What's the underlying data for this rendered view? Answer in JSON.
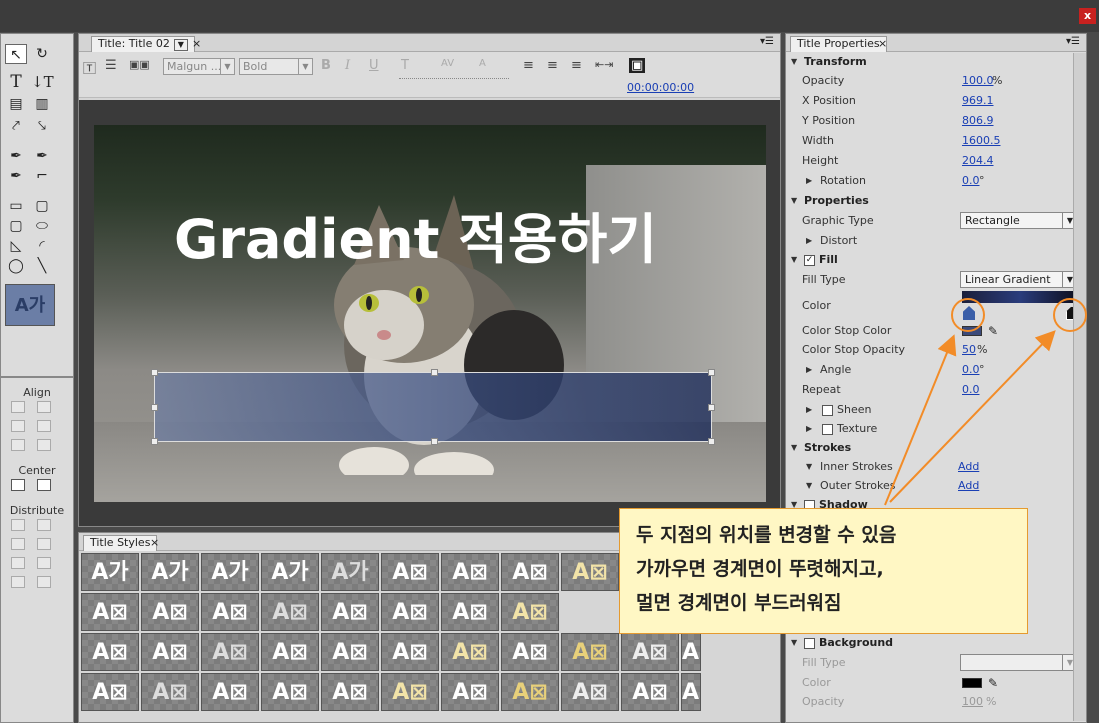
{
  "window": {
    "close_label": "x"
  },
  "tools": {
    "style_preview": "A가"
  },
  "align": {
    "title": "Align",
    "center": "Center",
    "distribute": "Distribute"
  },
  "main": {
    "tab_label": "Title: Title 02",
    "tab_dropdown": "▼",
    "close": "×",
    "font_family": "Malgun ...",
    "font_style": "Bold",
    "timecode": "00:00:00:00",
    "canvas_title": "Gradient 적용하기"
  },
  "styles": {
    "tab_label": "Title Styles",
    "close": "×",
    "row1": [
      "A가",
      "A가",
      "A가",
      "A가",
      "A가",
      "A⊠",
      "A⊠",
      "A⊠",
      "A⊠"
    ],
    "row2": [
      "A⊠",
      "A⊠",
      "A⊠",
      "A⊠",
      "A⊠",
      "A⊠",
      "A⊠",
      "A⊠"
    ],
    "row3": [
      "A⊠",
      "A⊠",
      "A⊠",
      "A⊠",
      "A⊠",
      "A⊠",
      "A⊠",
      "A⊠",
      "A⊠",
      "A⊠",
      "A⊠"
    ],
    "row4": [
      "A⊠",
      "A⊠",
      "A⊠",
      "A⊠",
      "A⊠",
      "A⊠",
      "A⊠",
      "A⊠",
      "A⊠",
      "A⊠",
      "A⊠"
    ]
  },
  "props": {
    "tab_label": "Title Properties",
    "close": "×",
    "transform": "Transform",
    "opacity_label": "Opacity",
    "opacity_value": "100.0",
    "opacity_unit": "%",
    "xpos_label": "X Position",
    "xpos_value": "969.1",
    "ypos_label": "Y Position",
    "ypos_value": "806.9",
    "width_label": "Width",
    "width_value": "1600.5",
    "height_label": "Height",
    "height_value": "204.4",
    "rotation_label": "Rotation",
    "rotation_value": "0.0",
    "rotation_unit": "°",
    "properties": "Properties",
    "graphic_type_label": "Graphic Type",
    "graphic_type_value": "Rectangle",
    "distort_label": "Distort",
    "fill": "Fill",
    "fill_type_label": "Fill Type",
    "fill_type_value": "Linear Gradient",
    "color_label": "Color",
    "stop_color_label": "Color Stop Color",
    "stop_opacity_label": "Color Stop Opacity",
    "stop_opacity_value": "50",
    "stop_opacity_unit": "%",
    "angle_label": "Angle",
    "angle_value": "0.0",
    "angle_unit": "°",
    "repeat_label": "Repeat",
    "repeat_value": "0.0",
    "sheen_label": "Sheen",
    "texture_label": "Texture",
    "strokes": "Strokes",
    "inner_label": "Inner Strokes",
    "inner_add": "Add",
    "outer_label": "Outer Strokes",
    "outer_add": "Add",
    "shadow": "Shadow",
    "background": "Background",
    "bg_fill_type_label": "Fill Type",
    "bg_color_label": "Color",
    "bg_opacity_label": "Opacity",
    "bg_opacity_value": "100",
    "bg_opacity_unit": "%"
  },
  "callout": {
    "line1": "두 지점의 위치를 변경할 수 있음",
    "line2": "가까우면 경계면이 뚜렷해지고,",
    "line3": "멀면 경계면이 부드러워짐"
  },
  "colors": {
    "accent": "#f28c28",
    "link": "#1a3fb4",
    "close": "#c8211f"
  }
}
